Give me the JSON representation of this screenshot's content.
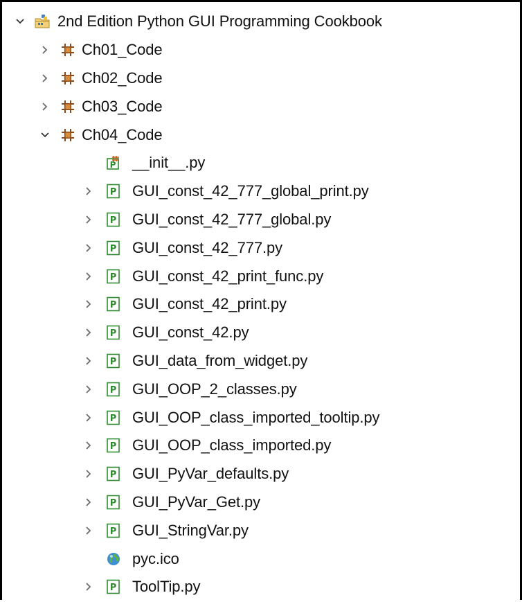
{
  "project": {
    "label": "2nd Edition Python GUI Programming Cookbook",
    "expanded": true,
    "icon": "python-project-icon"
  },
  "packages": [
    {
      "label": "Ch01_Code",
      "expanded": false,
      "icon": "package-icon"
    },
    {
      "label": "Ch02_Code",
      "expanded": false,
      "icon": "package-icon"
    },
    {
      "label": "Ch03_Code",
      "expanded": false,
      "icon": "package-icon"
    },
    {
      "label": "Ch04_Code",
      "expanded": true,
      "icon": "package-icon"
    }
  ],
  "files": [
    {
      "label": "__init__.py",
      "has_children": false,
      "icon": "init-file-icon"
    },
    {
      "label": "GUI_const_42_777_global_print.py",
      "has_children": true,
      "icon": "python-file-icon"
    },
    {
      "label": "GUI_const_42_777_global.py",
      "has_children": true,
      "icon": "python-file-icon"
    },
    {
      "label": "GUI_const_42_777.py",
      "has_children": true,
      "icon": "python-file-icon"
    },
    {
      "label": "GUI_const_42_print_func.py",
      "has_children": true,
      "icon": "python-file-icon"
    },
    {
      "label": "GUI_const_42_print.py",
      "has_children": true,
      "icon": "python-file-icon"
    },
    {
      "label": "GUI_const_42.py",
      "has_children": true,
      "icon": "python-file-icon"
    },
    {
      "label": "GUI_data_from_widget.py",
      "has_children": true,
      "icon": "python-file-icon"
    },
    {
      "label": "GUI_OOP_2_classes.py",
      "has_children": true,
      "icon": "python-file-icon"
    },
    {
      "label": "GUI_OOP_class_imported_tooltip.py",
      "has_children": true,
      "icon": "python-file-icon"
    },
    {
      "label": "GUI_OOP_class_imported.py",
      "has_children": true,
      "icon": "python-file-icon"
    },
    {
      "label": "GUI_PyVar_defaults.py",
      "has_children": true,
      "icon": "python-file-icon"
    },
    {
      "label": "GUI_PyVar_Get.py",
      "has_children": true,
      "icon": "python-file-icon"
    },
    {
      "label": "GUI_StringVar.py",
      "has_children": true,
      "icon": "python-file-icon"
    },
    {
      "label": "pyc.ico",
      "has_children": false,
      "icon": "globe-icon"
    },
    {
      "label": "ToolTip.py",
      "has_children": true,
      "icon": "python-file-icon"
    }
  ],
  "colors": {
    "chevron": "#6b6b6b",
    "package": "#8b4a1a",
    "file_green": "#2e8b2e"
  }
}
